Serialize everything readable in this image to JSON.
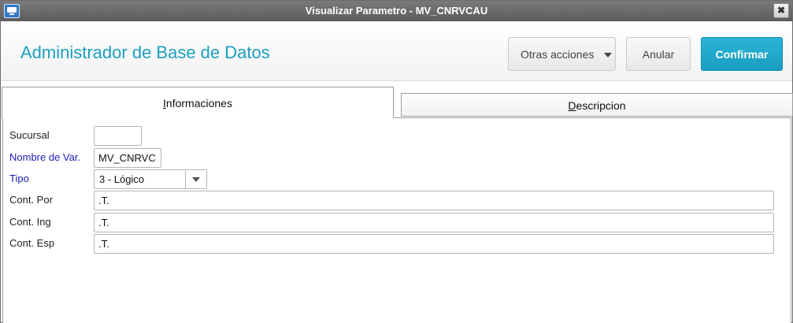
{
  "window": {
    "title": "Visualizar Parametro - MV_CNRVCAU",
    "close_label": "✖"
  },
  "header": {
    "title": "Administrador de Base de Datos",
    "more_actions_label": "Otras acciones",
    "cancel_label": "Anular",
    "confirm_label": "Confirmar"
  },
  "tabs": {
    "info": {
      "accesskey": "I",
      "rest": "nformaciones"
    },
    "desc": {
      "accesskey": "D",
      "rest": "escripcion"
    }
  },
  "form": {
    "sucursal": {
      "label": "Sucursal",
      "value": ""
    },
    "nombre": {
      "label": "Nombre de Var.",
      "value": "MV_CNRVC"
    },
    "tipo": {
      "label": "Tipo",
      "value": "3 - Lógico"
    },
    "cont_por": {
      "label": "Cont. Por",
      "value": ".T."
    },
    "cont_ing": {
      "label": "Cont. Ing",
      "value": ".T."
    },
    "cont_esp": {
      "label": "Cont. Esp",
      "value": ".T."
    }
  },
  "colors": {
    "accent": "#1b9fc0",
    "confirm": "#1a9ec2",
    "required_label": "#1c1cb8"
  },
  "icons": {
    "window": "app-window-icon",
    "close": "close-icon",
    "more_actions": "caret-down-icon",
    "tipo_dropdown": "chevron-down-icon"
  }
}
